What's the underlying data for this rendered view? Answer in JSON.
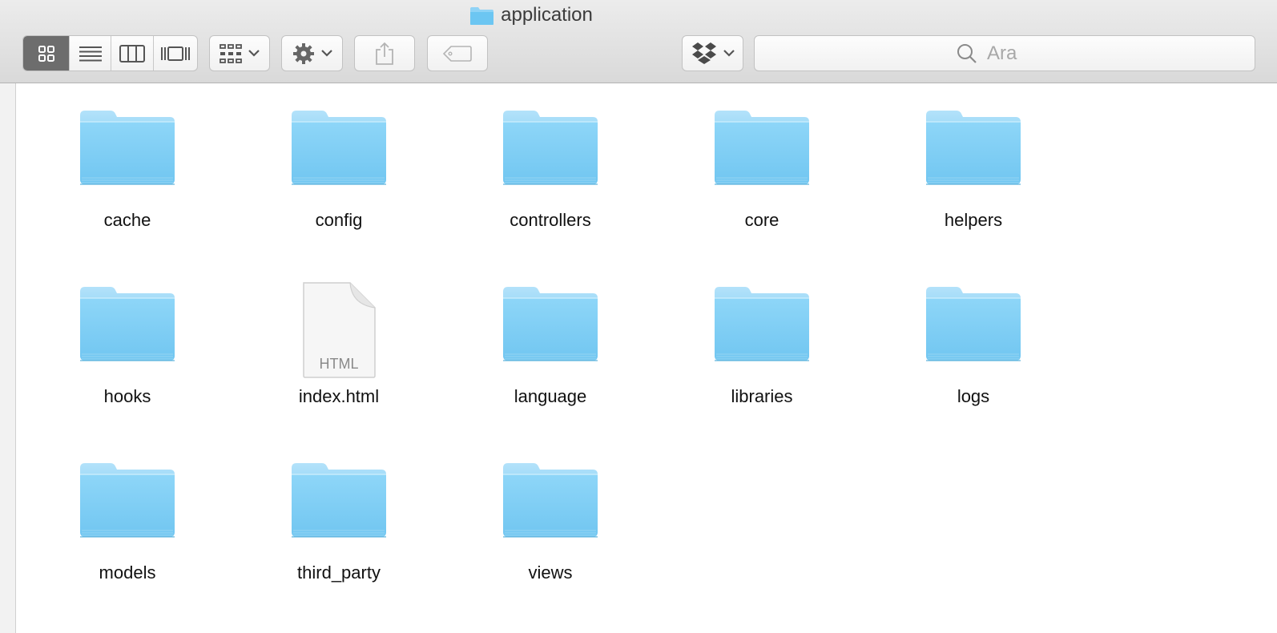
{
  "window": {
    "title": "application"
  },
  "toolbar": {
    "view_modes": [
      {
        "name": "icon-view",
        "icon": "grid-icon",
        "active": true
      },
      {
        "name": "list-view",
        "icon": "list-icon",
        "active": false
      },
      {
        "name": "column-view",
        "icon": "columns-icon",
        "active": false
      },
      {
        "name": "cover-flow-view",
        "icon": "cover-flow-icon",
        "active": false
      }
    ],
    "arrange_icon": "arrange-grid-icon",
    "action_icon": "gear-icon",
    "share_icon": "share-icon",
    "tags_icon": "tag-icon",
    "dropbox_icon": "dropbox-icon",
    "search_placeholder": "Ara"
  },
  "colors": {
    "folder_top": "#a7dcf8",
    "folder_body": "#86d1f5",
    "active_segment": "#6d6d6d"
  },
  "items": [
    {
      "label": "cache",
      "kind": "folder"
    },
    {
      "label": "config",
      "kind": "folder"
    },
    {
      "label": "controllers",
      "kind": "folder"
    },
    {
      "label": "core",
      "kind": "folder"
    },
    {
      "label": "helpers",
      "kind": "folder"
    },
    {
      "label": "hooks",
      "kind": "folder"
    },
    {
      "label": "index.html",
      "kind": "file",
      "file_type": "HTML"
    },
    {
      "label": "language",
      "kind": "folder"
    },
    {
      "label": "libraries",
      "kind": "folder"
    },
    {
      "label": "logs",
      "kind": "folder"
    },
    {
      "label": "models",
      "kind": "folder"
    },
    {
      "label": "third_party",
      "kind": "folder"
    },
    {
      "label": "views",
      "kind": "folder"
    }
  ]
}
